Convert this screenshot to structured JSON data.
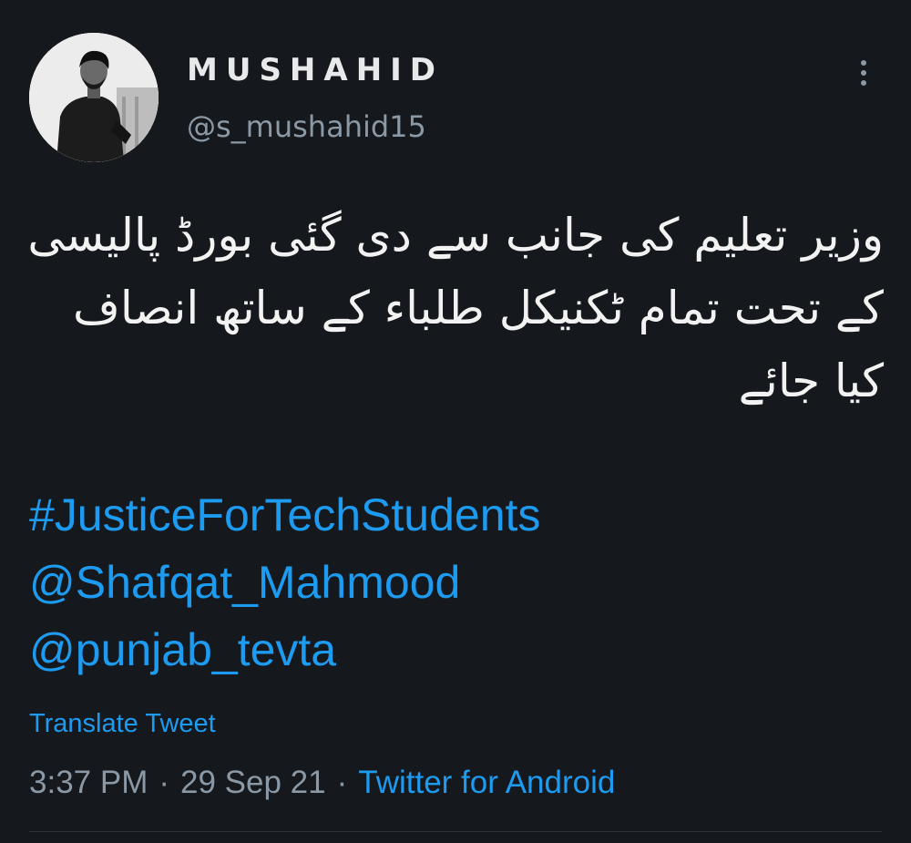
{
  "user": {
    "display_name": "MUSHAHID",
    "handle": "@s_mushahid15"
  },
  "icons": {
    "avatar": "profile-photo",
    "more": "more-vertical-icon"
  },
  "tweet": {
    "text_lines": [
      "وزیر تعلیم کی جانب سے دی گئی بورڈ پالیسی",
      "کے تحت تمام ٹکنیکل طلباء کے ساتھ انصاف",
      "کیا جائے"
    ],
    "hashtag": "#JusticeForTechStudents",
    "mentions": [
      "@Shafqat_Mahmood",
      "@punjab_tevta"
    ],
    "translate_label": "Translate Tweet"
  },
  "meta": {
    "time": "3:37 PM",
    "separator": "·",
    "date": "29 Sep 21",
    "source": "Twitter for Android"
  },
  "colors": {
    "background": "#15181c",
    "link": "#1d9bf0",
    "secondary_text": "#8b98a5",
    "primary_text": "#e7e9ea"
  }
}
